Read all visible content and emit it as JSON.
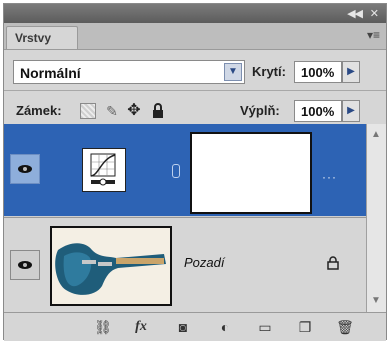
{
  "panel": {
    "tab_label": "Vrstvy",
    "blend_mode": "Normální",
    "opacity_label": "Krytí:",
    "opacity_value": "100%",
    "lock_label": "Zámek:",
    "fill_label": "Výplň:",
    "fill_value": "100%"
  },
  "layers": [
    {
      "name": "",
      "type": "adjustment-curves",
      "selected": true,
      "visible": true
    },
    {
      "name": "Pozadí",
      "type": "image",
      "selected": false,
      "visible": true,
      "locked": true
    }
  ],
  "colors": {
    "selection": "#2d63b4",
    "panel_bg": "#d6d6d6"
  },
  "icons": {
    "link": "link-layers-icon",
    "fx": "layer-style-icon",
    "mask": "add-mask-icon",
    "adjustment": "new-adjustment-icon",
    "group": "new-group-icon",
    "new_layer": "new-layer-icon",
    "trash": "delete-layer-icon"
  }
}
